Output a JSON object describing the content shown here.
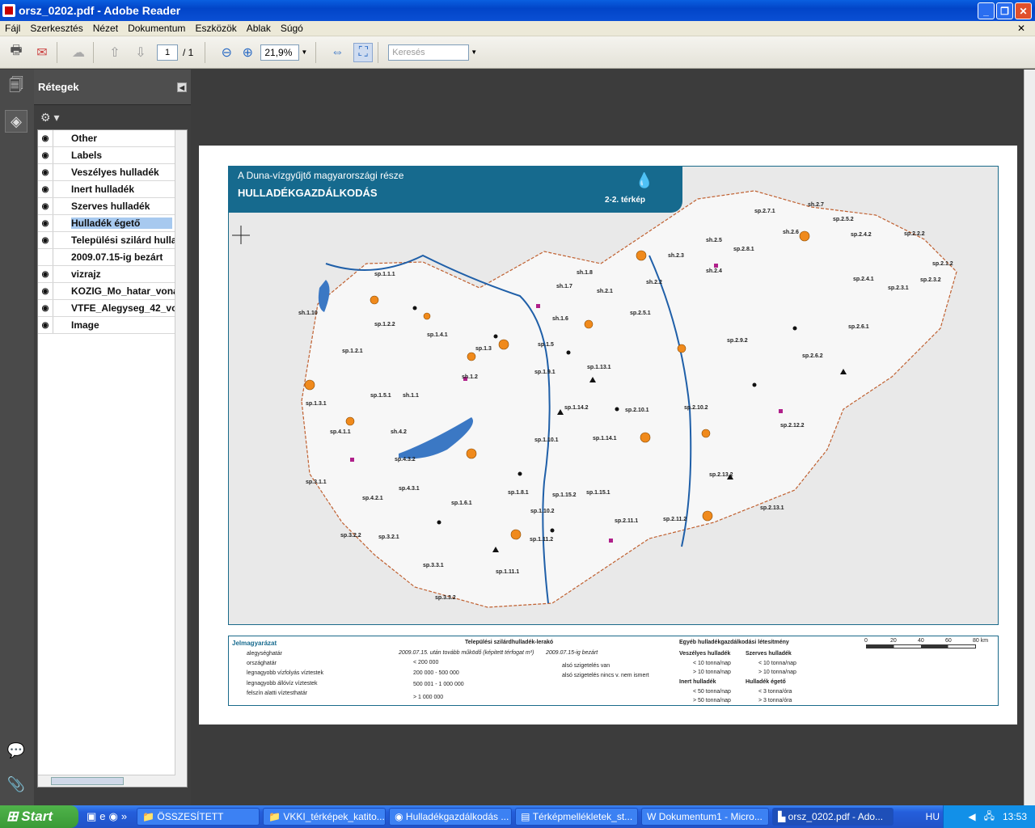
{
  "window": {
    "title": "orsz_0202.pdf - Adobe Reader"
  },
  "menu": [
    "Fájl",
    "Szerkesztés",
    "Nézet",
    "Dokumentum",
    "Eszközök",
    "Ablak",
    "Súgó"
  ],
  "toolbar": {
    "page_current": "1",
    "page_total": "/ 1",
    "zoom": "21,9%",
    "search_placeholder": "Keresés"
  },
  "panel": {
    "title": "Rétegek"
  },
  "layers": [
    {
      "name": "Other",
      "visible": true
    },
    {
      "name": "Labels",
      "visible": true
    },
    {
      "name": "Veszélyes hulladék",
      "visible": true
    },
    {
      "name": "Inert hulladék",
      "visible": true
    },
    {
      "name": "Szerves hulladék",
      "visible": true
    },
    {
      "name": "Hulladék égető",
      "visible": true,
      "selected": true
    },
    {
      "name": "Települési szilárd hulla",
      "visible": true
    },
    {
      "name": "2009.07.15-ig bezárt",
      "visible": false
    },
    {
      "name": "vizrajz",
      "visible": true
    },
    {
      "name": "KOZIG_Mo_hatar_vona",
      "visible": true
    },
    {
      "name": "VTFE_Alegyseg_42_vo",
      "visible": true
    },
    {
      "name": "Image",
      "visible": true
    }
  ],
  "map": {
    "subtitle": "A Duna-vízgyűjtő magyarországi része",
    "title": "HULLADÉKGAZDÁLKODÁS",
    "map_number": "2-2. térkép",
    "labels": [
      "sp.1.1.1",
      "sh.1.10",
      "sp.1.2.2",
      "sp.1.2.1",
      "sp.1.4.1",
      "sp.1.3",
      "sh.1.2",
      "sp.1.3.1",
      "sp.1.5.1",
      "sh.1.1",
      "sp.4.1.1",
      "sh.4.2",
      "sp.4.3.2",
      "sp.3.1.1",
      "sp.4.2.1",
      "sp.4.3.1",
      "sp.3.2.2",
      "sp.3.2.1",
      "sp.3.3.1",
      "sp.3.3.2",
      "sh.1.7",
      "sh.1.8",
      "sh.2.1",
      "sh.1.6",
      "sp.1.5",
      "sp.1.9.1",
      "sp.1.13.1",
      "sp.1.14.2",
      "sp.1.14.1",
      "sp.1.10.1",
      "sp.1.8.1",
      "sp.1.6.1",
      "sp.1.15.2",
      "sp.1.15.1",
      "sp.1.10.2",
      "sp.1.11.2",
      "sp.1.11.1",
      "sh.2.2",
      "sh.2.3",
      "sh.2.4",
      "sh.2.5",
      "sp.2.5.1",
      "sp.2.8.1",
      "sp.2.9.2",
      "sp.2.10.1",
      "sp.2.10.2",
      "sp.2.11.1",
      "sp.2.11.2",
      "sp.2.13.2",
      "sp.2.13.1",
      "sp.2.12.2",
      "sp.2.6.2",
      "sp.2.6.1",
      "sp.2.4.1",
      "sp.2.4.2",
      "sp.2.5.2",
      "sp.2.2.2",
      "sp.2.1.2",
      "sp.2.3.2",
      "sp.2.3.1",
      "sp.2.7.1",
      "sh.2.7",
      "sh.2.6"
    ]
  },
  "legend": {
    "title": "Jelmagyarázat",
    "lines": [
      "alegységhatár",
      "országhatár",
      "legnagyobb vízfolyás víztestek",
      "legnagyobb állóvíz víztestek",
      "felszín alatti víztesthatár"
    ],
    "landfill_title": "Települési szilárdhulladék-lerakó",
    "landfill_sub1": "2009.07.15. után tovább működő (képitett térfogat m³)",
    "landfill_sub2": "2009.07.15-ig bezárt",
    "sizes": [
      "< 200 000",
      "200 000 - 500 000",
      "500 001 - 1 000 000",
      "> 1 000 000"
    ],
    "closed": [
      "alsó szigetelés van",
      "alsó szigetelés nincs v. nem ismert"
    ],
    "other_title": "Egyéb hulladékgazdálkodási létesítmény",
    "haz_title": "Veszélyes hulladék",
    "haz": [
      "< 10 tonna/nap",
      "> 10 tonna/nap"
    ],
    "org_title": "Szerves hulladék",
    "org": [
      "< 10 tonna/nap",
      "> 10 tonna/nap"
    ],
    "inert_title": "Inert hulladék",
    "inert": [
      "< 50 tonna/nap",
      "> 50 tonna/nap"
    ],
    "incin_title": "Hulladék égető",
    "incin": [
      "< 3 tonna/óra",
      "> 3 tonna/óra"
    ],
    "scale": [
      "0",
      "20",
      "40",
      "60",
      "80 km"
    ]
  },
  "taskbar": {
    "start": "Start",
    "tasks": [
      "ÖSSZESÍTETT",
      "VKKI_térképek_katito...",
      "Hulladékgazdálkodás ...",
      "Térképmellékletek_st...",
      "Dokumentum1 - Micro...",
      "orsz_0202.pdf - Ado..."
    ],
    "lang": "HU",
    "clock": "13:53"
  }
}
